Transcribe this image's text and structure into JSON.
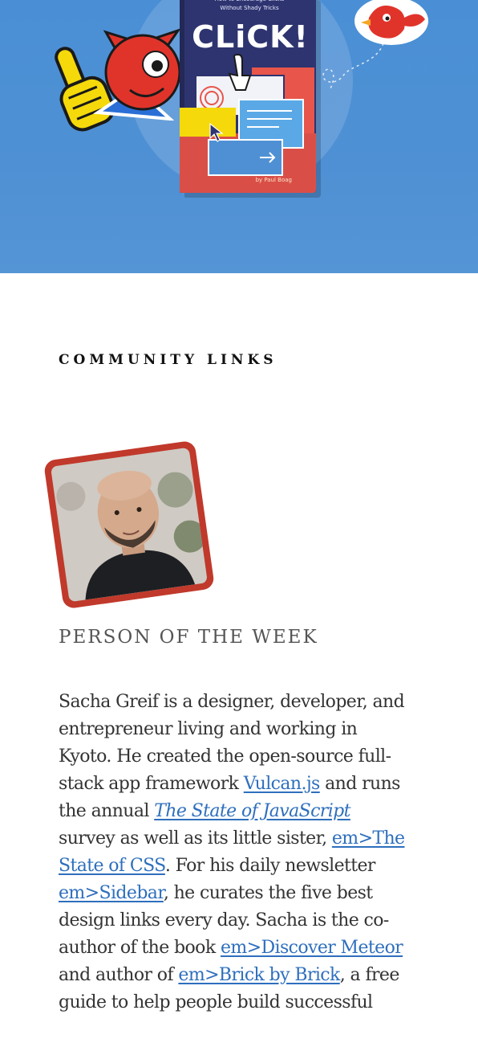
{
  "banner": {
    "book": {
      "subtitle": "How to Encourage Clicks\nWithout Shady Tricks",
      "title": "CLiCK!",
      "author": "by Paul Boag"
    },
    "colors": {
      "background": "#4f90d4",
      "mascot": "#e0342b",
      "foam_hand": "#f5d90a",
      "book": "#2e3470"
    },
    "icons": [
      "cat-mascot-icon",
      "foam-hand-icon",
      "bird-mascot-icon",
      "cursor-icon"
    ]
  },
  "section": {
    "heading": "COMMUNITY LINKS"
  },
  "person": {
    "label": "PERSON OF THE WEEK",
    "photo_frame_color": "#c0392b",
    "bio": {
      "t1": "Sacha Greif is a designer, developer, and entrepreneur living and working in Kyoto. He created the open-source full-stack app framework ",
      "link_vulcan": "Vulcan.js",
      "t2": " and runs the annual ",
      "link_state_js": "The State of JavaScript",
      "t3": " survey as well as its little sister, ",
      "link_state_css": "em>The State of CSS",
      "t4": ". For his daily newsletter ",
      "link_sidebar": "em>Sidebar",
      "t5": ", he curates the five best design links every day. Sacha is the co-author of the book ",
      "link_meteor": "em>Discover Meteor",
      "t6": " and author of ",
      "link_brick": "em>Brick by Brick",
      "t7": ", a free guide to help people build successful"
    },
    "link_color": "#2e6fbd"
  }
}
